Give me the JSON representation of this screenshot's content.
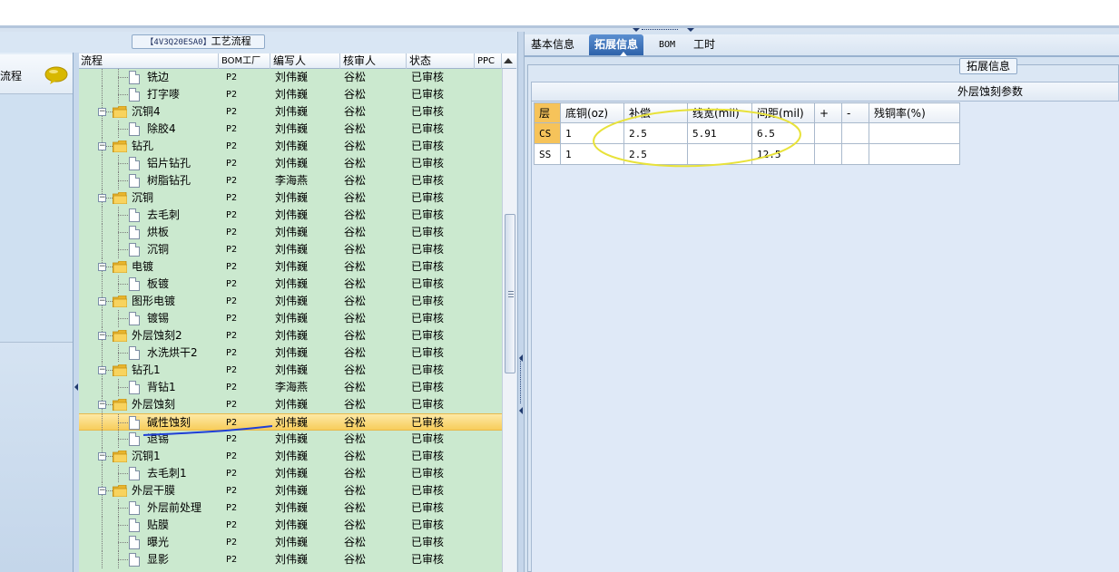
{
  "left_nav": {
    "label": "流程"
  },
  "left_panel": {
    "caption_code": "【4V3Q20ESA0】",
    "caption_label": "工艺流程"
  },
  "grid": {
    "headers": {
      "process": "流程",
      "bom_factory": "BOM工厂",
      "writer": "编写人",
      "reviewer": "核审人",
      "status": "状态",
      "ppc": "PPC"
    },
    "rows": [
      {
        "name": "铣边",
        "type": "doc",
        "level": 2,
        "bom": "P2",
        "writer": "刘伟巍",
        "reviewer": "谷松",
        "status": "已审核"
      },
      {
        "name": "打字嘜",
        "type": "doc",
        "level": 2,
        "bom": "P2",
        "writer": "刘伟巍",
        "reviewer": "谷松",
        "status": "已审核"
      },
      {
        "name": "沉铜4",
        "type": "folder",
        "level": 1,
        "bom": "P2",
        "writer": "刘伟巍",
        "reviewer": "谷松",
        "status": "已审核"
      },
      {
        "name": "除胶4",
        "type": "doc",
        "level": 2,
        "bom": "P2",
        "writer": "刘伟巍",
        "reviewer": "谷松",
        "status": "已审核"
      },
      {
        "name": "钻孔",
        "type": "folder",
        "level": 1,
        "bom": "P2",
        "writer": "刘伟巍",
        "reviewer": "谷松",
        "status": "已审核"
      },
      {
        "name": "铝片钻孔",
        "type": "doc",
        "level": 2,
        "bom": "P2",
        "writer": "刘伟巍",
        "reviewer": "谷松",
        "status": "已审核"
      },
      {
        "name": "树脂钻孔",
        "type": "doc",
        "level": 2,
        "bom": "P2",
        "writer": "李海燕",
        "reviewer": "谷松",
        "status": "已审核"
      },
      {
        "name": "沉铜",
        "type": "folder",
        "level": 1,
        "bom": "P2",
        "writer": "刘伟巍",
        "reviewer": "谷松",
        "status": "已审核"
      },
      {
        "name": "去毛刺",
        "type": "doc",
        "level": 2,
        "bom": "P2",
        "writer": "刘伟巍",
        "reviewer": "谷松",
        "status": "已审核"
      },
      {
        "name": "烘板",
        "type": "doc",
        "level": 2,
        "bom": "P2",
        "writer": "刘伟巍",
        "reviewer": "谷松",
        "status": "已审核"
      },
      {
        "name": "沉铜",
        "type": "doc",
        "level": 2,
        "bom": "P2",
        "writer": "刘伟巍",
        "reviewer": "谷松",
        "status": "已审核"
      },
      {
        "name": "电镀",
        "type": "folder",
        "level": 1,
        "bom": "P2",
        "writer": "刘伟巍",
        "reviewer": "谷松",
        "status": "已审核"
      },
      {
        "name": "板镀",
        "type": "doc",
        "level": 2,
        "bom": "P2",
        "writer": "刘伟巍",
        "reviewer": "谷松",
        "status": "已审核"
      },
      {
        "name": "图形电镀",
        "type": "folder",
        "level": 1,
        "bom": "P2",
        "writer": "刘伟巍",
        "reviewer": "谷松",
        "status": "已审核"
      },
      {
        "name": "镀锡",
        "type": "doc",
        "level": 2,
        "bom": "P2",
        "writer": "刘伟巍",
        "reviewer": "谷松",
        "status": "已审核"
      },
      {
        "name": "外层蚀刻2",
        "type": "folder",
        "level": 1,
        "bom": "P2",
        "writer": "刘伟巍",
        "reviewer": "谷松",
        "status": "已审核"
      },
      {
        "name": "水洗烘干2",
        "type": "doc",
        "level": 2,
        "bom": "P2",
        "writer": "刘伟巍",
        "reviewer": "谷松",
        "status": "已审核"
      },
      {
        "name": "钻孔1",
        "type": "folder",
        "level": 1,
        "bom": "P2",
        "writer": "刘伟巍",
        "reviewer": "谷松",
        "status": "已审核"
      },
      {
        "name": "背钻1",
        "type": "doc",
        "level": 2,
        "bom": "P2",
        "writer": "李海燕",
        "reviewer": "谷松",
        "status": "已审核"
      },
      {
        "name": "外层蚀刻",
        "type": "folder",
        "level": 1,
        "bom": "P2",
        "writer": "刘伟巍",
        "reviewer": "谷松",
        "status": "已审核"
      },
      {
        "name": "碱性蚀刻",
        "type": "doc",
        "level": 2,
        "bom": "P2",
        "writer": "刘伟巍",
        "reviewer": "谷松",
        "status": "已审核",
        "selected": true
      },
      {
        "name": "退锡",
        "type": "doc",
        "level": 2,
        "bom": "P2",
        "writer": "刘伟巍",
        "reviewer": "谷松",
        "status": "已审核"
      },
      {
        "name": "沉铜1",
        "type": "folder",
        "level": 1,
        "bom": "P2",
        "writer": "刘伟巍",
        "reviewer": "谷松",
        "status": "已审核"
      },
      {
        "name": "去毛刺1",
        "type": "doc",
        "level": 2,
        "bom": "P2",
        "writer": "刘伟巍",
        "reviewer": "谷松",
        "status": "已审核"
      },
      {
        "name": "外层干膜",
        "type": "folder",
        "level": 1,
        "bom": "P2",
        "writer": "刘伟巍",
        "reviewer": "谷松",
        "status": "已审核"
      },
      {
        "name": "外层前处理",
        "type": "doc",
        "level": 2,
        "bom": "P2",
        "writer": "刘伟巍",
        "reviewer": "谷松",
        "status": "已审核"
      },
      {
        "name": "贴膜",
        "type": "doc",
        "level": 2,
        "bom": "P2",
        "writer": "刘伟巍",
        "reviewer": "谷松",
        "status": "已审核"
      },
      {
        "name": "曝光",
        "type": "doc",
        "level": 2,
        "bom": "P2",
        "writer": "刘伟巍",
        "reviewer": "谷松",
        "status": "已审核"
      },
      {
        "name": "显影",
        "type": "doc",
        "level": 2,
        "bom": "P2",
        "writer": "刘伟巍",
        "reviewer": "谷松",
        "status": "已审核"
      }
    ]
  },
  "tabs": [
    {
      "label": "基本信息",
      "active": false
    },
    {
      "label": "拓展信息",
      "active": true
    },
    {
      "label": "BOM",
      "active": false
    },
    {
      "label": "工时",
      "active": false
    }
  ],
  "ext_panel": {
    "caption": "拓展信息",
    "section_title": "外层蚀刻参数",
    "table": {
      "headers": [
        "层",
        "底铜(oz)",
        "补偿",
        "线宽(mil)",
        "间距(mil)",
        "+",
        "-",
        "残铜率(%)"
      ],
      "rows": [
        [
          "CS",
          "1",
          "2.5",
          "5.91",
          "6.5",
          "",
          "",
          ""
        ],
        [
          "SS",
          "1",
          "2.5",
          "",
          "12.5",
          "",
          "",
          ""
        ]
      ]
    }
  },
  "colors": {
    "grid_bg": "#cbe9cf",
    "selected_row": "#f7cd5b",
    "active_tab": "#2e62aa",
    "annotation_ellipse": "#e8e23a",
    "annotation_underline": "#1f3fd6"
  }
}
